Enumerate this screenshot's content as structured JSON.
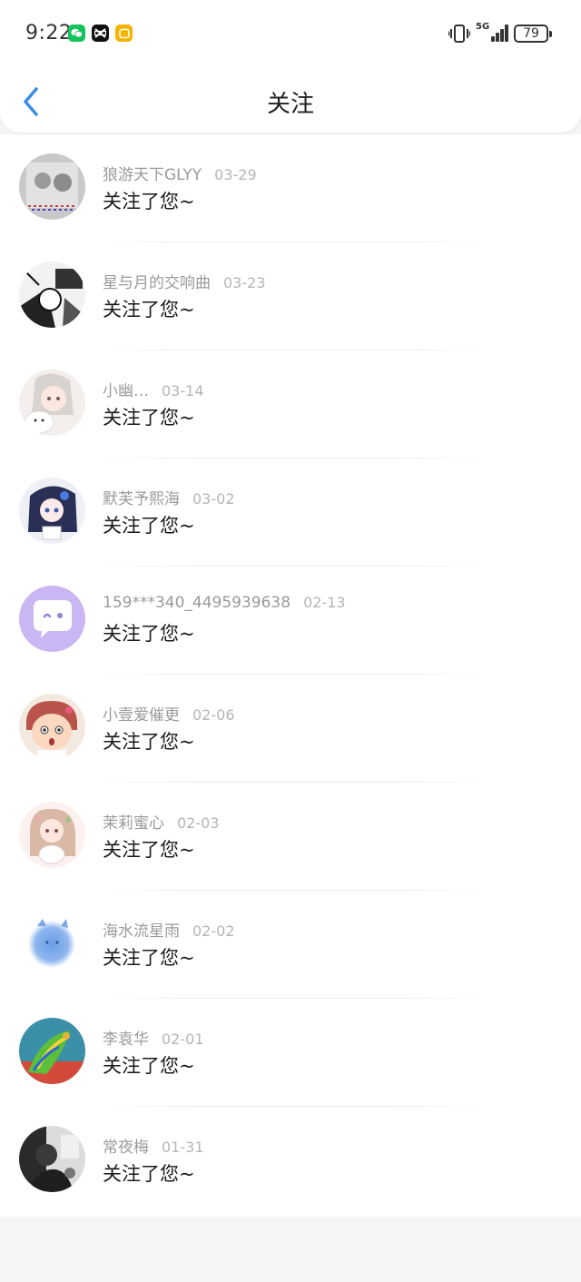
{
  "status_bar": {
    "time": "9:22",
    "network": "5G",
    "battery": "79",
    "apps": [
      {
        "icon": "wechat-icon",
        "color": "#15c45b"
      },
      {
        "icon": "capcut-icon",
        "color": "#111111"
      },
      {
        "icon": "notes-app-icon",
        "color": "#f5b400"
      }
    ]
  },
  "header": {
    "title": "关注",
    "back_icon": "chevron-left-icon",
    "accent_color": "#3a8ee6"
  },
  "followers": [
    {
      "name": "狼游天下GLYY",
      "date": "03-29",
      "message": "关注了您~"
    },
    {
      "name": "星与月的交响曲",
      "date": "03-23",
      "message": "关注了您~"
    },
    {
      "name": "小幽…",
      "date": "03-14",
      "message": "关注了您~"
    },
    {
      "name": "默芙予熙海",
      "date": "03-02",
      "message": "关注了您~"
    },
    {
      "name": "159***340_4495939638",
      "date": "02-13",
      "message": "关注了您~"
    },
    {
      "name": "小壹爱催更",
      "date": "02-06",
      "message": "关注了您~"
    },
    {
      "name": "茉莉蜜心",
      "date": "02-03",
      "message": "关注了您~"
    },
    {
      "name": "海水流星雨",
      "date": "02-02",
      "message": "关注了您~"
    },
    {
      "name": "李袁华",
      "date": "02-01",
      "message": "关注了您~"
    },
    {
      "name": "常夜梅",
      "date": "01-31",
      "message": "关注了您~"
    }
  ]
}
